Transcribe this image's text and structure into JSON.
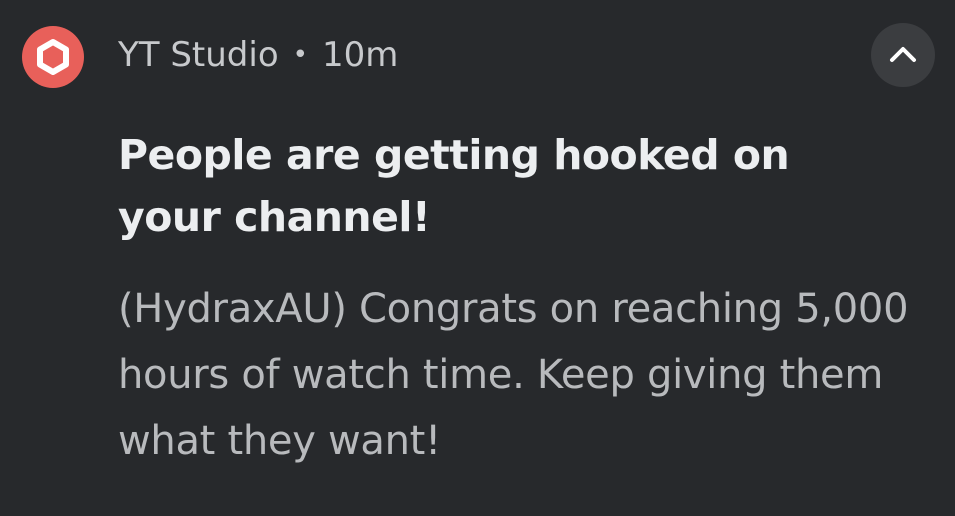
{
  "notification": {
    "app_name": "YT Studio",
    "separator": "•",
    "time": "10m",
    "title": "People are getting hooked on your channel!",
    "body": "(HydraxAU) Congrats on reaching 5,000 hours of watch time. Keep giving them what they want!",
    "app_icon": "yt-studio-hexagon-icon",
    "expand_icon": "chevron-up-icon"
  },
  "colors": {
    "background": "#27292c",
    "app_icon_accent": "#e8605a",
    "title_text": "#eceef0",
    "body_text": "#b8babd",
    "expand_button_bg": "#3b3d40"
  }
}
